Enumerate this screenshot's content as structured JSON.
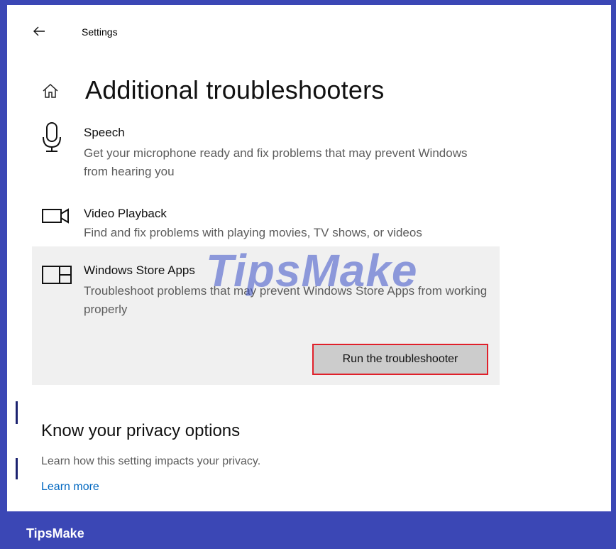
{
  "window": {
    "title": "Settings",
    "back_icon": "arrow-left-icon"
  },
  "page": {
    "title": "Additional troubleshooters",
    "home_icon": "home-icon"
  },
  "troubleshooters": [
    {
      "name": "Speech",
      "description": "Get your microphone ready and fix problems that may prevent Windows from hearing you",
      "icon": "microphone-icon"
    },
    {
      "name": "Video Playback",
      "description": "Find and fix problems with playing movies, TV shows, or videos",
      "icon": "video-camera-icon"
    },
    {
      "name": "Windows Store Apps",
      "description": "Troubleshoot problems that may prevent Windows Store Apps from working properly",
      "icon": "store-apps-icon",
      "selected": true,
      "action_label": "Run the troubleshooter"
    }
  ],
  "privacy": {
    "heading": "Know your privacy options",
    "description": "Learn how this setting impacts your privacy.",
    "link_label": "Learn more"
  },
  "watermark": {
    "text": "TipsMake"
  },
  "footer": {
    "brand": "TipsMake"
  },
  "colors": {
    "frame": "#3b47b5",
    "link": "#0067c0",
    "highlight_border": "#e0202a",
    "selected_bg": "#f0f0f0",
    "button_bg": "#cccccc"
  }
}
